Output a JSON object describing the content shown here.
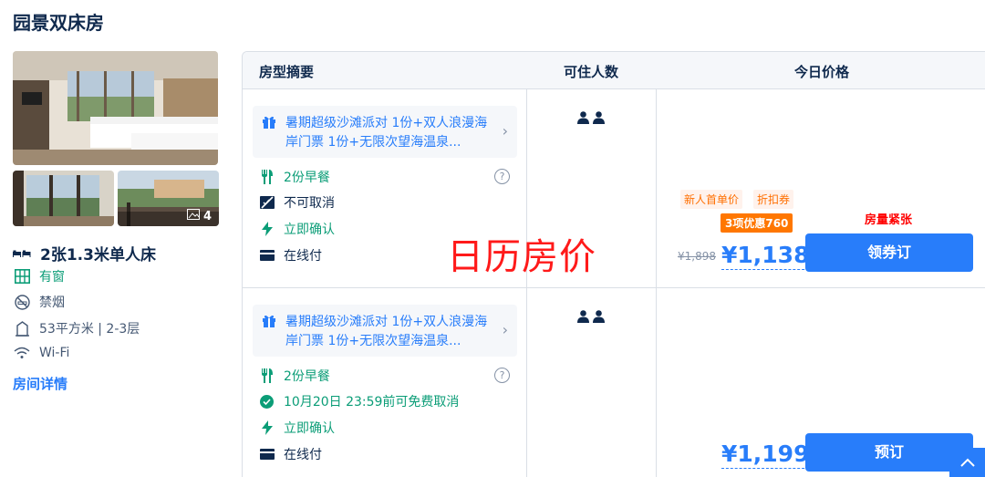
{
  "room": {
    "title": "园景双床房",
    "photo_count": "4",
    "features": [
      {
        "icon": "twin-bed-icon",
        "label": "2张1.3米单人床"
      },
      {
        "icon": "window-icon",
        "label": "有窗"
      },
      {
        "icon": "no-smoking-icon",
        "label": "禁烟"
      },
      {
        "icon": "area-icon",
        "label": "53平方米 | 2-3层"
      },
      {
        "icon": "wifi-icon",
        "label": "Wi-Fi"
      }
    ],
    "detail_link": "房间详情"
  },
  "table": {
    "headers": [
      "房型摘要",
      "可住人数",
      "今日价格"
    ],
    "rows": [
      {
        "package": "暑期超级沙滩派对 1份+双人浪漫海岸门票 1份+无限次望海温泉...",
        "breakfast": "2份早餐",
        "cancel": "不可取消",
        "confirm": "立即确认",
        "payment": "在线付",
        "tags": [
          "新人首单价",
          "折扣券"
        ],
        "deal": "3项优惠760",
        "original_price": "¥1,898",
        "price": "¥1,138",
        "stock_note": "房量紧张",
        "button": "领券订"
      },
      {
        "package": "暑期超级沙滩派对 1份+双人浪漫海岸门票 1份+无限次望海温泉...",
        "breakfast": "2份早餐",
        "cancel": "10月20日 23:59前可免费取消",
        "confirm": "立即确认",
        "payment": "在线付",
        "price": "¥1,199",
        "button": "预订"
      }
    ]
  },
  "overlay_text": "日历房价",
  "colors": {
    "primary": "#287dfa",
    "title": "#0f294d",
    "green": "#0b9d77",
    "orange": "#ff7700",
    "red": "#ff1a1a"
  }
}
